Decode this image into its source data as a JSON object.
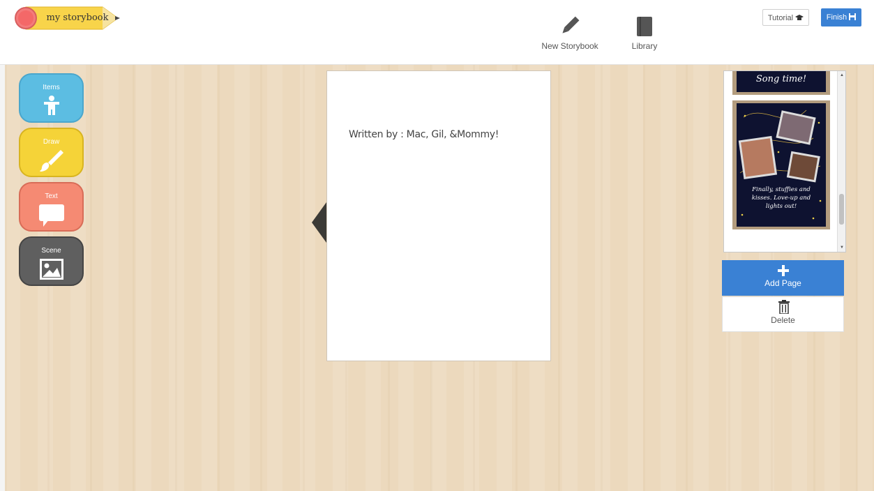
{
  "app": {
    "logo_text": "my storybook"
  },
  "header": {
    "new_storybook_label": "New Storybook",
    "library_label": "Library",
    "tutorial_label": "Tutorial",
    "finish_label": "Finish"
  },
  "tools": {
    "items_label": "Items",
    "draw_label": "Draw",
    "text_label": "Text",
    "scene_label": "Scene"
  },
  "page": {
    "text": "Written by : Mac, Gil, &Mommy!"
  },
  "thumbnails": {
    "top_page_title": "Song time!",
    "current_page_caption_line1": "Finally, stuffies and",
    "current_page_caption_line2": "kisses. Love-up and",
    "current_page_caption_line3": "lights out!"
  },
  "page_actions": {
    "add_label": "Add Page",
    "delete_label": "Delete"
  },
  "colors": {
    "accent": "#3a81d4",
    "items": "#5cbde2",
    "draw": "#f5d338",
    "text": "#f58a73",
    "scene": "#5f5f5f",
    "wood": "#ecd9bd"
  },
  "icons": {
    "new_storybook": "pencil-icon",
    "library": "book-icon",
    "tutorial": "graduation-cap-icon",
    "finish": "save-icon",
    "items": "person-icon",
    "draw": "brush-icon",
    "text": "speech-bubble-icon",
    "scene": "image-icon",
    "add": "plus-icon",
    "delete": "trash-icon"
  }
}
